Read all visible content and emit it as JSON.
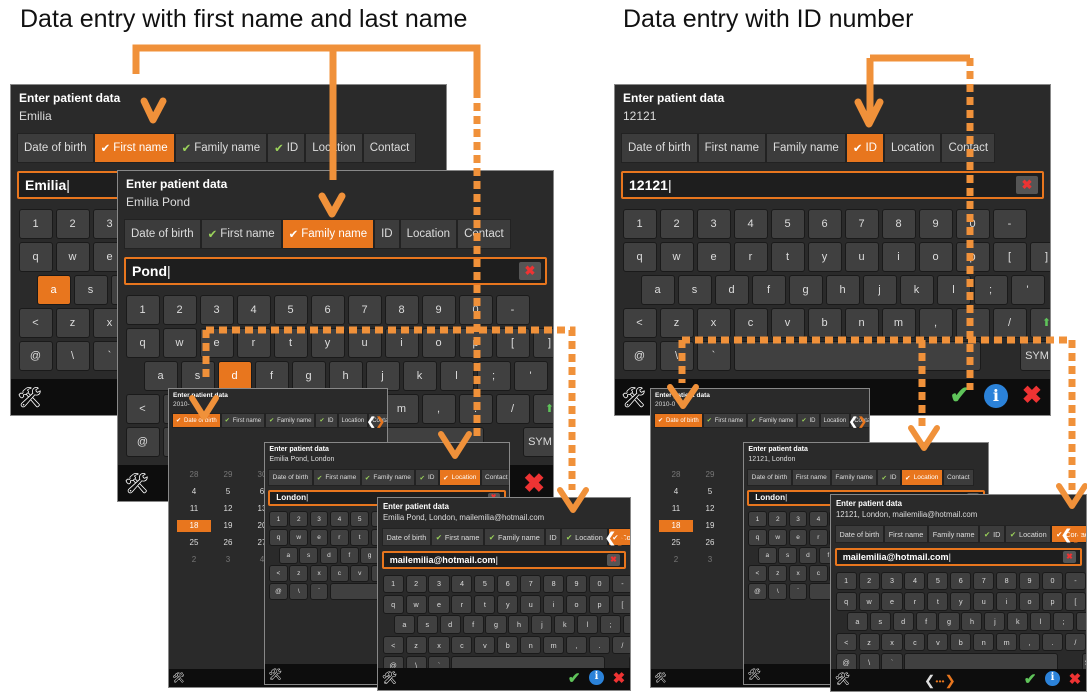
{
  "captions": {
    "left": "Data entry with first name and last name",
    "right": "Data entry with ID number"
  },
  "heading": "Enter patient data",
  "tabs": {
    "dob": "Date of birth",
    "first": "First name",
    "family": "Family name",
    "id": "ID",
    "location": "Location",
    "contact": "Contact"
  },
  "keys": {
    "row1": [
      "1",
      "2",
      "3",
      "4",
      "5",
      "6",
      "7",
      "8",
      "9",
      "0",
      "-"
    ],
    "row2": [
      "q",
      "w",
      "e",
      "r",
      "t",
      "y",
      "u",
      "i",
      "o",
      "p",
      "[",
      "]"
    ],
    "row3": [
      "a",
      "s",
      "d",
      "f",
      "g",
      "h",
      "j",
      "k",
      "l",
      ";",
      "'"
    ],
    "row4": [
      "<",
      "z",
      "x",
      "c",
      "v",
      "b",
      "n",
      "m",
      ",",
      ".",
      "/"
    ],
    "row5_at": "@",
    "row5_bs": "\\",
    "row5_tick": "`",
    "sym": "SYM"
  },
  "screens": {
    "first": {
      "summary": "Emilia",
      "input": "Emilia"
    },
    "family": {
      "summary": "Emilia Pond",
      "input": "Pond"
    },
    "dob": {
      "summary": "2010-",
      "year": "2010",
      "cal": [
        "28",
        "29",
        "30",
        "4",
        "5",
        "6",
        "11",
        "12",
        "13",
        "18",
        "19",
        "20",
        "25",
        "26",
        "27",
        "2",
        "3",
        "4"
      ]
    },
    "location": {
      "summary": "Emilia Pond, London",
      "input": "London"
    },
    "contact": {
      "summary": "Emilia Pond, London, mailemilia@hotmail.com",
      "input": "mailemilia@hotmail.com"
    },
    "id": {
      "summary": "12121",
      "input": "12121"
    },
    "id_dob": {
      "summary": "2010-0",
      "year": "2010",
      "cal": [
        "28",
        "29",
        "4",
        "5",
        "11",
        "12",
        "18",
        "19",
        "25",
        "26",
        "2",
        "3"
      ]
    },
    "id_location": {
      "summary": "12121, London",
      "input": "London"
    },
    "id_contact": {
      "summary": "12121, London, mailemilia@hotmail.com",
      "input": "mailemilia@hotmail.com"
    }
  },
  "colors": {
    "accent": "#e8761e",
    "check": "#5fc45a",
    "delete": "#e33333",
    "info": "#2b82d9",
    "window": "#2a2a2a"
  }
}
